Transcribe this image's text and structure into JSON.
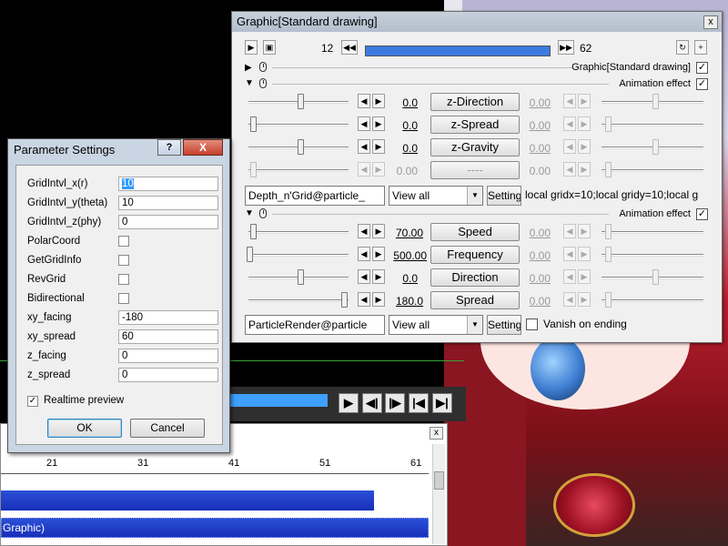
{
  "graphic_window": {
    "title": "Graphic[Standard drawing]",
    "close_glyph": "x",
    "frame_start": "12",
    "frame_end": "62",
    "nav": {
      "first_glyph": "◀◀",
      "last_glyph": "▶▶",
      "plus_glyph": "+"
    },
    "object_label": "Graphic[Standard drawing]",
    "effect1": {
      "title": "Animation effect",
      "params": [
        {
          "left": "0.0",
          "name": "z-Direction",
          "right": "0.00"
        },
        {
          "left": "0.0",
          "name": "z-Spread",
          "right": "0.00"
        },
        {
          "left": "0.0",
          "name": "z-Gravity",
          "right": "0.00"
        },
        {
          "left": "0.00",
          "name": "----",
          "right": "0.00"
        }
      ],
      "script_select": "Depth_n'Grid@particle_",
      "view_select": "View all",
      "setting_label": "Setting",
      "setting_text": "local gridx=10;local gridy=10;local g"
    },
    "effect2": {
      "title": "Animation effect",
      "params": [
        {
          "left": "70.00",
          "name": "Speed",
          "right": "0.00"
        },
        {
          "left": "500.00",
          "name": "Frequency",
          "right": "0.00"
        },
        {
          "left": "0.0",
          "name": "Direction",
          "right": "0.00"
        },
        {
          "left": "180.0",
          "name": "Spread",
          "right": "0.00"
        }
      ],
      "script_select": "ParticleRender@particle",
      "view_select": "View all",
      "setting_label": "Setting",
      "vanish_label": "Vanish on ending"
    }
  },
  "param_dialog": {
    "title": "Parameter Settings",
    "help_glyph": "?",
    "close_glyph": "X",
    "fields": [
      {
        "label": "GridIntvl_x(r)",
        "value": "10",
        "type": "text"
      },
      {
        "label": "GridIntvl_y(theta)",
        "value": "10",
        "type": "text"
      },
      {
        "label": "GridIntvl_z(phy)",
        "value": "0",
        "type": "text"
      },
      {
        "label": "PolarCoord",
        "type": "check"
      },
      {
        "label": "GetGridInfo",
        "type": "check"
      },
      {
        "label": "RevGrid",
        "type": "check"
      },
      {
        "label": "Bidirectional",
        "type": "check"
      },
      {
        "label": "xy_facing",
        "value": "-180",
        "type": "text"
      },
      {
        "label": "xy_spread",
        "value": "60",
        "type": "text"
      },
      {
        "label": "z_facing",
        "value": "0",
        "type": "text"
      },
      {
        "label": "z_spread",
        "value": "0",
        "type": "text"
      }
    ],
    "realtime_label": "Realtime preview",
    "ok_label": "OK",
    "cancel_label": "Cancel"
  },
  "timeline": {
    "ticks": [
      "21",
      "31",
      "41",
      "51",
      "61"
    ],
    "clip2_label": "Graphic)",
    "close_glyph": "x"
  },
  "playback": {
    "buttons": [
      "▶",
      "◀|",
      "|▶",
      "|◀",
      "▶|"
    ]
  }
}
